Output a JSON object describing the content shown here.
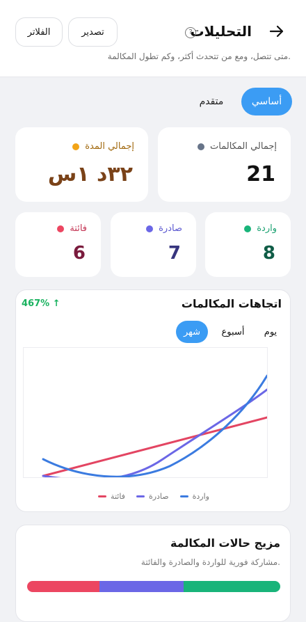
{
  "header": {
    "back_icon": "arrow-right-icon",
    "title": "التحليلات",
    "help_icon": "question-circle-icon",
    "help_glyph": "?",
    "subtitle": "متى تتصل، ومع من تتحدث أكثر، وكم تطول المكالمة.",
    "export_label": "تصدير",
    "filters_label": "الفلاتر"
  },
  "view_tabs": {
    "basic": "أساسي",
    "advanced": "متقدم",
    "active": "basic"
  },
  "summary": {
    "total_calls_label": "إجمالي المكالمات",
    "total_calls_value": "21",
    "total_duration_label": "إجمالي المدة",
    "total_duration_value": "٣٢د ١س"
  },
  "counts": {
    "incoming_label": "واردة",
    "incoming_value": "8",
    "outgoing_label": "صادرة",
    "outgoing_value": "7",
    "missed_label": "فائتة",
    "missed_value": "6"
  },
  "trends": {
    "title": "اتجاهات المكالمات",
    "change": "467% ↑",
    "periods": [
      "يوم",
      "أسبوع",
      "شهر"
    ],
    "active_period": "شهر",
    "legend": {
      "incoming": "واردة",
      "outgoing": "صادرة",
      "missed": "فائتة"
    }
  },
  "mix": {
    "title": "مزيج حالات المكالمة",
    "subtitle": "مشاركة فورية للواردة والصادرة والفائتة.",
    "shares": {
      "incoming": 8,
      "outgoing": 7,
      "missed": 6
    }
  },
  "colors": {
    "accent": "#3b9cf4",
    "incoming": "#19b47a",
    "outgoing": "#6b67e6",
    "missed": "#ec4661",
    "incoming_line": "#3b7be0",
    "duration_dot": "#f2a417",
    "total_dot": "#677489"
  }
}
